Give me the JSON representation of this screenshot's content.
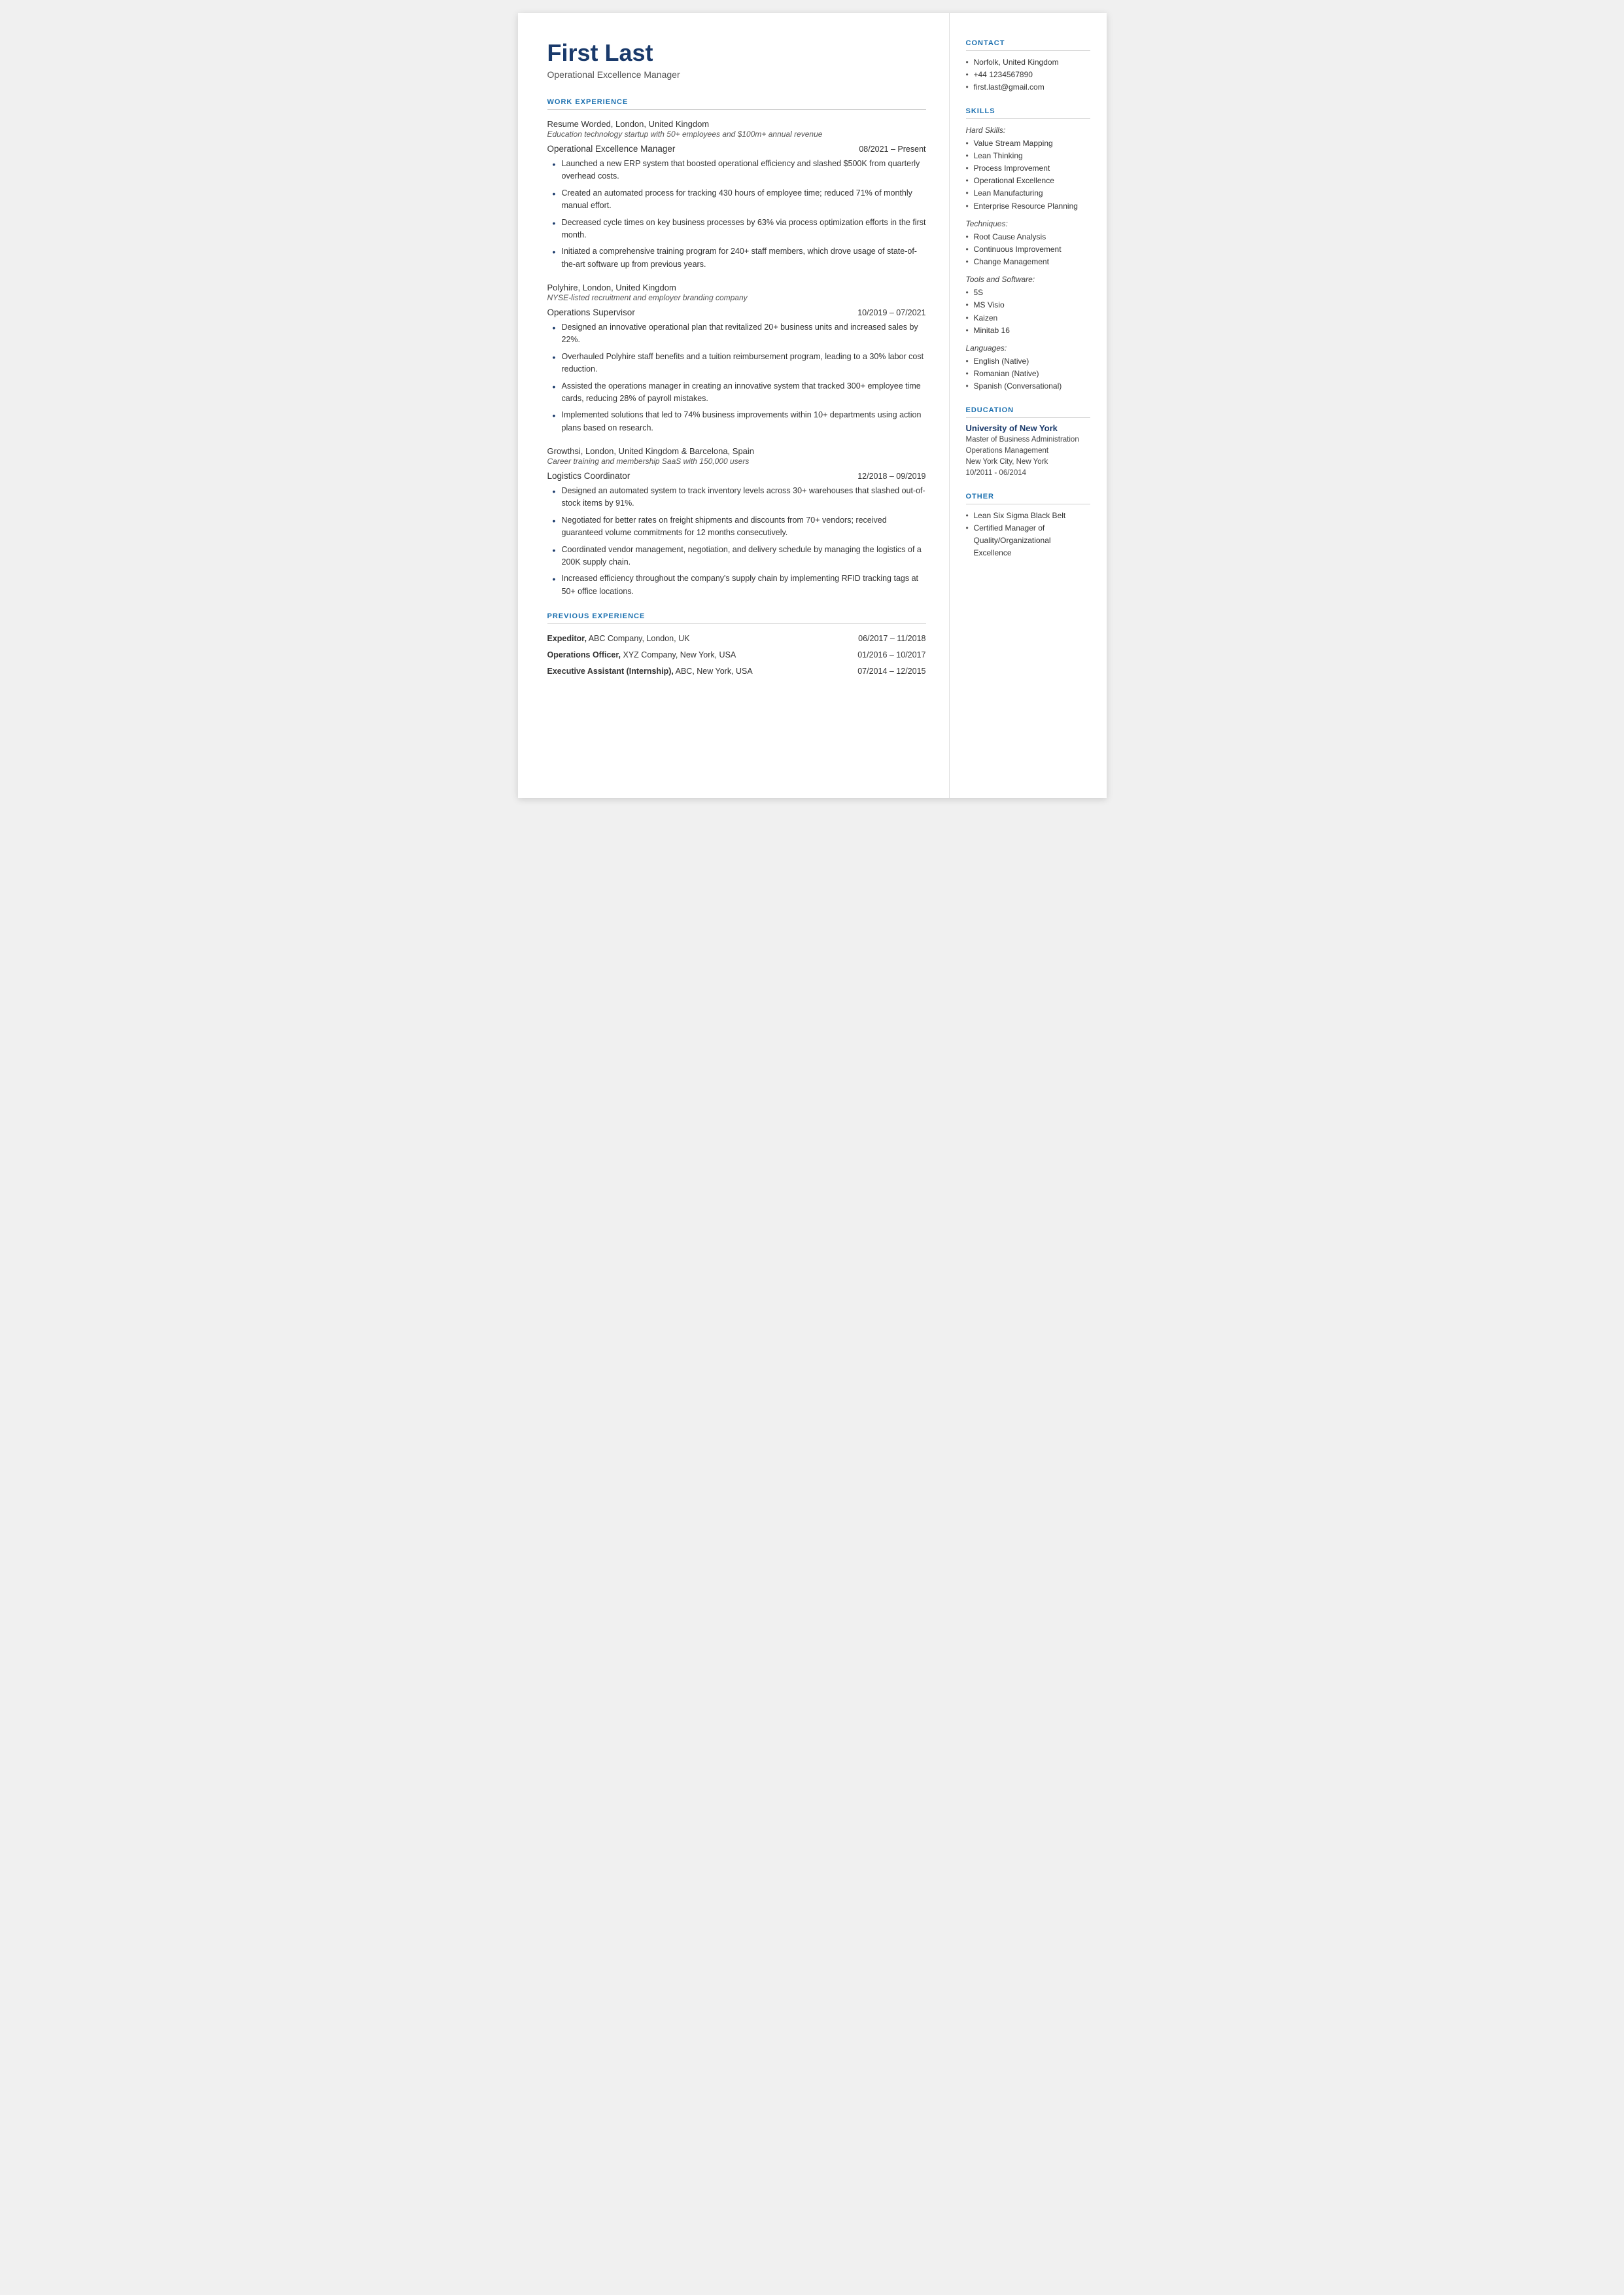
{
  "header": {
    "name": "First Last",
    "title": "Operational Excellence Manager"
  },
  "left": {
    "work_experience_label": "WORK EXPERIENCE",
    "jobs": [
      {
        "company": "Resume Worded,",
        "company_rest": " London, United Kingdom",
        "desc": "Education technology startup with 50+ employees and $100m+ annual revenue",
        "role": "Operational Excellence Manager",
        "dates": "08/2021 – Present",
        "bullets": [
          "Launched a new ERP system that boosted operational efficiency and slashed $500K from quarterly overhead costs.",
          "Created an automated process for tracking 430 hours of employee time; reduced 71% of monthly manual effort.",
          "Decreased cycle times on key business processes by 63% via process optimization efforts in the first month.",
          "Initiated a comprehensive training program for 240+ staff members, which drove usage of state-of-the-art software up from previous years."
        ]
      },
      {
        "company": "Polyhire,",
        "company_rest": " London, United Kingdom",
        "desc": "NYSE-listed recruitment and employer branding company",
        "role": "Operations Supervisor",
        "dates": "10/2019 – 07/2021",
        "bullets": [
          "Designed an innovative operational plan that revitalized 20+ business units and increased sales by 22%.",
          "Overhauled Polyhire staff benefits and a tuition reimbursement program, leading to a 30% labor cost reduction.",
          "Assisted the operations manager in creating an innovative system that tracked 300+ employee time cards, reducing 28% of payroll mistakes.",
          "Implemented solutions that led to 74% business improvements within 10+ departments using action plans based on research."
        ]
      },
      {
        "company": "Growthsi,",
        "company_rest": " London, United Kingdom & Barcelona, Spain",
        "desc": "Career training and membership SaaS with 150,000 users",
        "role": "Logistics Coordinator",
        "dates": "12/2018 – 09/2019",
        "bullets": [
          "Designed an automated system to track inventory levels across 30+ warehouses that slashed out-of-stock items by 91%.",
          "Negotiated for better rates on freight shipments and discounts from 70+ vendors; received guaranteed volume commitments for 12 months consecutively.",
          "Coordinated vendor management, negotiation, and delivery schedule by managing the logistics of a 200K supply chain.",
          "Increased efficiency throughout the company's supply chain by implementing RFID tracking tags at 50+ office locations."
        ]
      }
    ],
    "previous_experience_label": "PREVIOUS EXPERIENCE",
    "prev_jobs": [
      {
        "bold": "Expeditor,",
        "rest": " ABC Company, London, UK",
        "dates": "06/2017 – 11/2018"
      },
      {
        "bold": "Operations Officer,",
        "rest": " XYZ Company, New York, USA",
        "dates": "01/2016 – 10/2017"
      },
      {
        "bold": "Executive Assistant (Internship),",
        "rest": " ABC, New York, USA",
        "dates": "07/2014 – 12/2015"
      }
    ]
  },
  "right": {
    "contact_label": "CONTACT",
    "contact_items": [
      "Norfolk, United Kingdom",
      "+44 1234567890",
      "first.last@gmail.com"
    ],
    "skills_label": "SKILLS",
    "hard_skills_label": "Hard Skills:",
    "hard_skills": [
      "Value Stream Mapping",
      "Lean Thinking",
      "Process Improvement",
      "Operational Excellence",
      "Lean Manufacturing",
      "Enterprise Resource Planning"
    ],
    "techniques_label": "Techniques:",
    "techniques": [
      "Root Cause Analysis",
      "Continuous Improvement",
      "Change Management"
    ],
    "tools_label": "Tools and Software:",
    "tools": [
      "5S",
      "MS Visio",
      "Kaizen",
      "Minitab 16"
    ],
    "languages_label": "Languages:",
    "languages": [
      "English (Native)",
      "Romanian (Native)",
      "Spanish (Conversational)"
    ],
    "education_label": "EDUCATION",
    "education": [
      {
        "school": "University of New York",
        "degree": "Master of Business Administration",
        "field": "Operations Management",
        "location": "New York City, New York",
        "dates": "10/2011 - 06/2014"
      }
    ],
    "other_label": "OTHER",
    "other_items": [
      "Lean Six Sigma Black Belt",
      "Certified Manager of Quality/Organizational Excellence"
    ]
  }
}
